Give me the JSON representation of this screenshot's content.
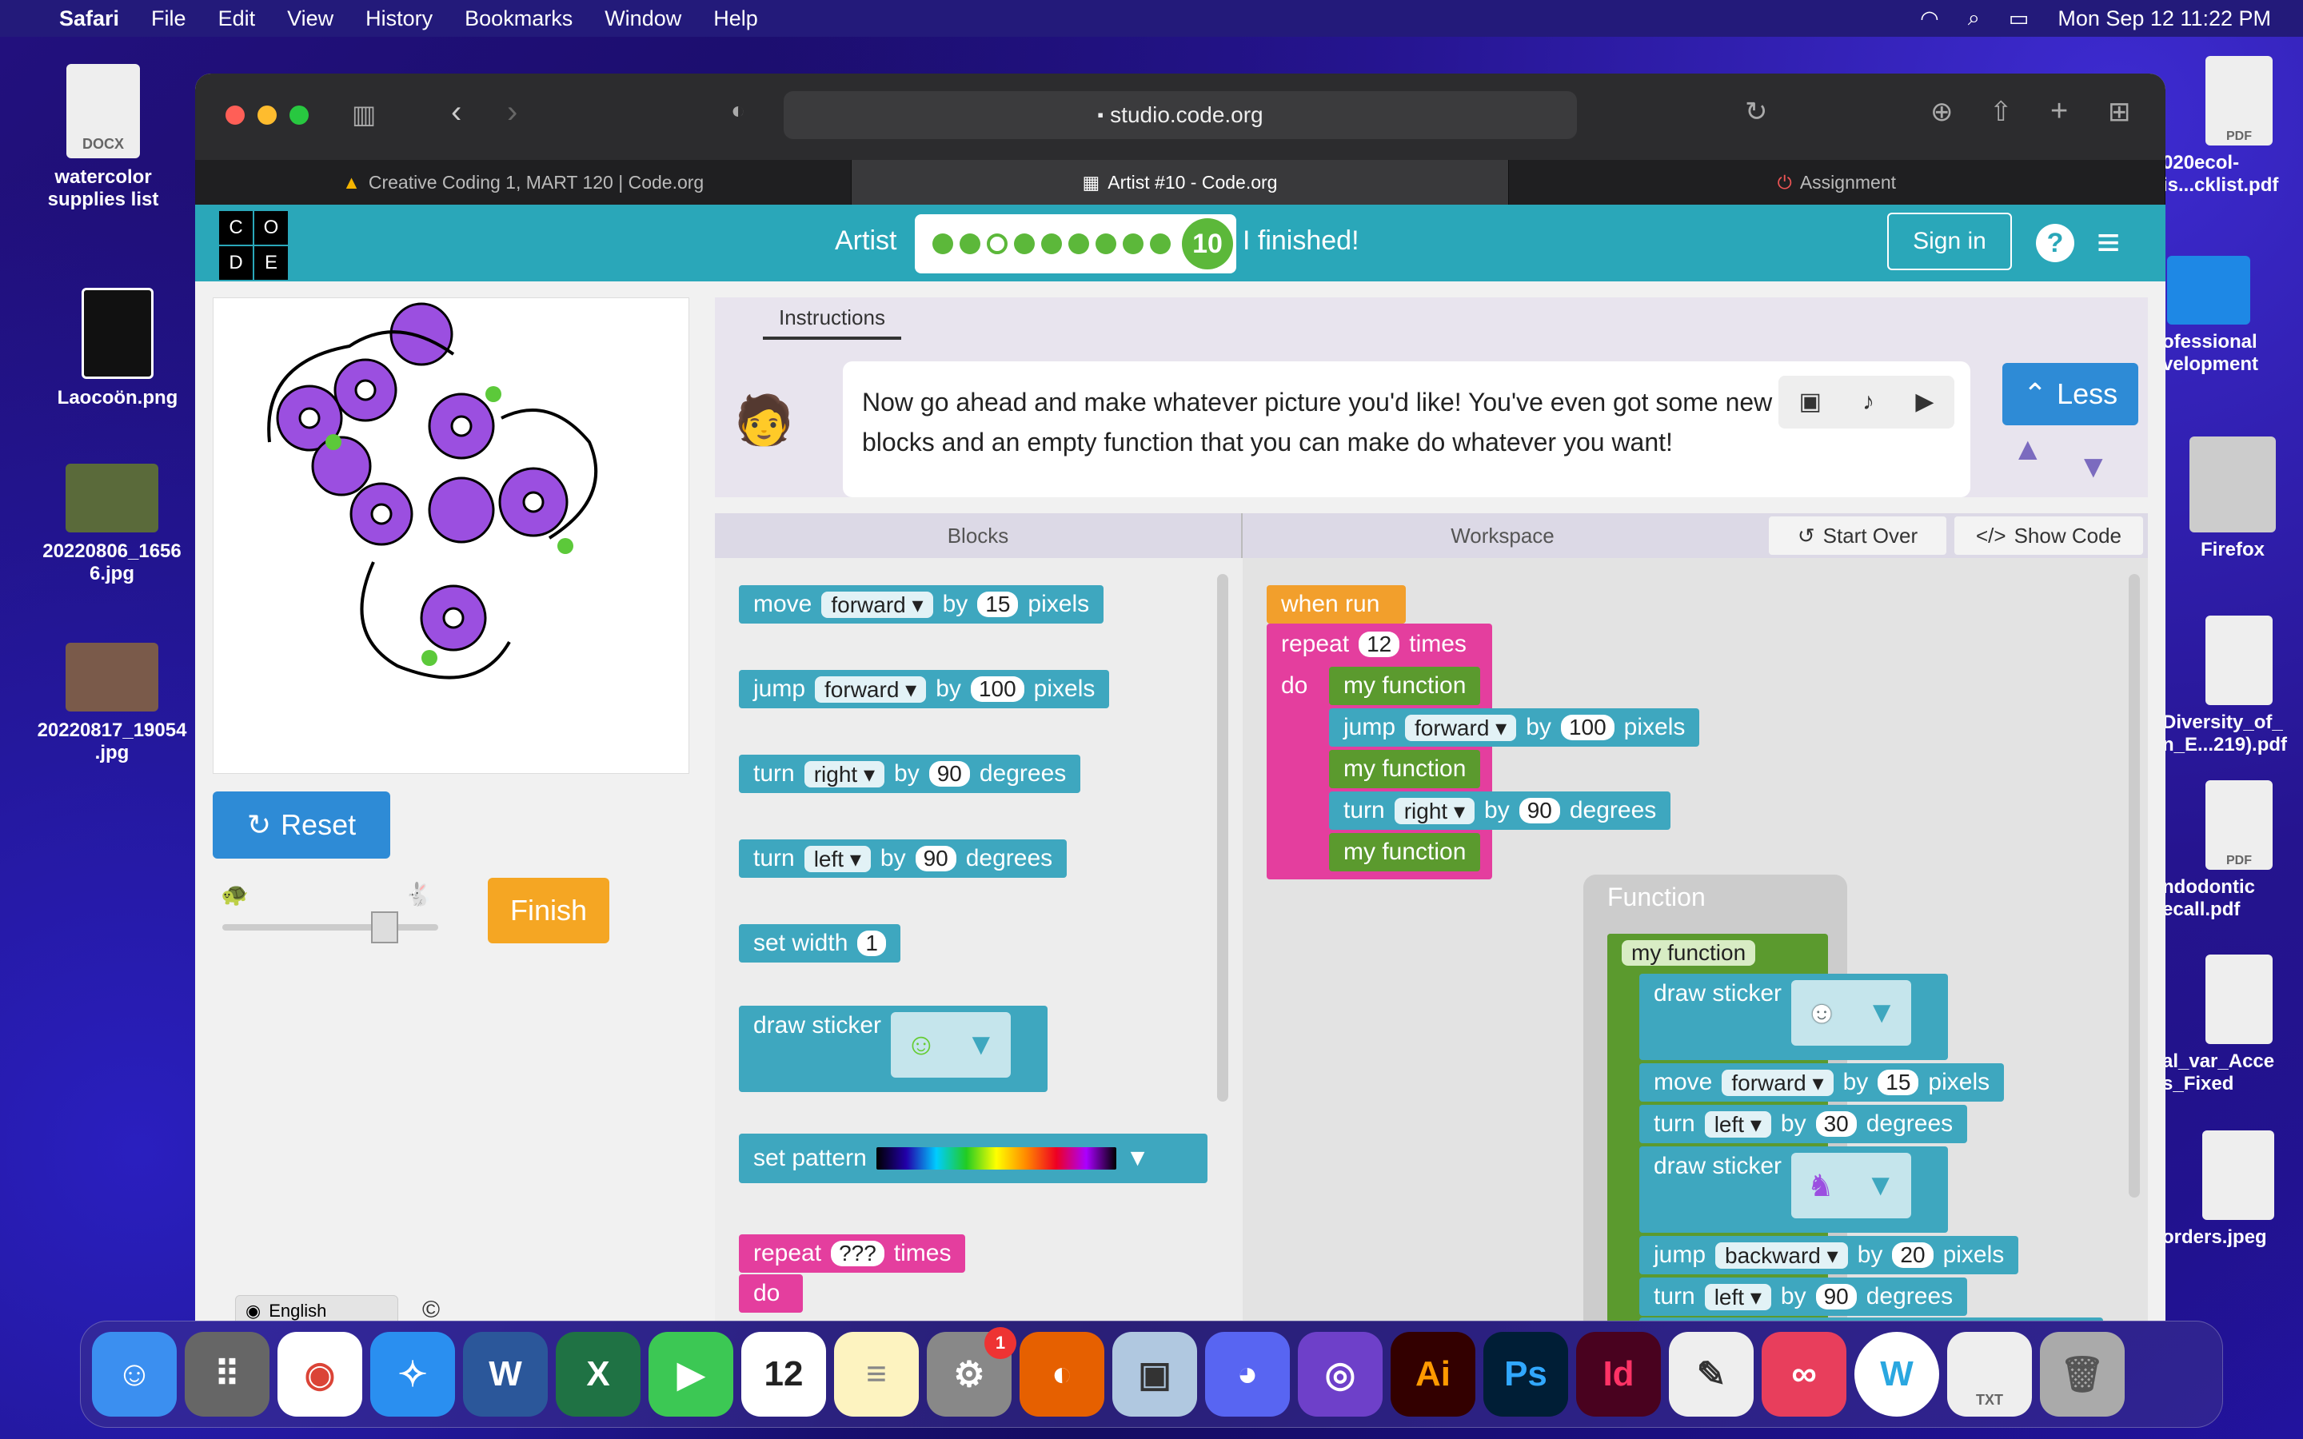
{
  "menubar": {
    "app": "Safari",
    "items": [
      "File",
      "Edit",
      "View",
      "History",
      "Bookmarks",
      "Window",
      "Help"
    ],
    "clock": "Mon Sep 12  11:22 PM"
  },
  "desktop": {
    "left": [
      "watercolor supplies list",
      "Laocoön.png",
      "20220806_16566.jpg",
      "20220817_190546.jpg"
    ],
    "left_display": [
      "watercolor\nsupplies list",
      "Laocoön.png",
      "20220806_1656\n6.jpg",
      "20220817_19054\n.jpg"
    ],
    "right": [
      "020ecol-is...cklist.pdf",
      "ofessional velopment",
      "Firefox",
      "Diversity_of_ n_E...219).pdf",
      "ndodontic ecall.pdf",
      "al_var_Acce s_Fixed",
      "orders.jpeg"
    ],
    "docx_label": "DOCX",
    "pdf_label": "PDF",
    "txt_label": "TXT"
  },
  "browser": {
    "url": "studio.code.org",
    "tabs": [
      "Creative Coding 1, MART 120 | Code.org",
      "Artist #10 - Code.org",
      "Assignment"
    ]
  },
  "header": {
    "logo": [
      "C",
      "O",
      "D",
      "E"
    ],
    "puzzle": "Artist",
    "level": "10",
    "finished": "I finished!",
    "signin": "Sign in"
  },
  "controls": {
    "reset": "Reset",
    "finish": "Finish",
    "language": "English"
  },
  "instructions": {
    "tab": "Instructions",
    "text": "Now go ahead and make whatever picture you'd like! You've even got some new blocks and an empty function that you can make do whatever you want!",
    "less": "Less"
  },
  "panels": {
    "blocks": "Blocks",
    "workspace": "Workspace",
    "start_over": "Start Over",
    "show_code": "Show Code"
  },
  "toolbox": {
    "move": "move",
    "forward": "forward",
    "by": "by",
    "fifteen": "15",
    "pixels": "pixels",
    "jump": "jump",
    "hundred": "100",
    "turn": "turn",
    "right": "right",
    "ninety": "90",
    "degrees": "degrees",
    "left": "left",
    "set_width": "set width",
    "one": "1",
    "draw_sticker": "draw sticker",
    "set_pattern": "set pattern",
    "repeat": "repeat",
    "qqq": "???",
    "times": "times",
    "do": "do"
  },
  "workspace_blocks": {
    "when_run": "when run",
    "repeat": "repeat",
    "twelve": "12",
    "times": "times",
    "do": "do",
    "my_function": "my function",
    "function_title": "Function",
    "backward": "backward",
    "twenty": "20",
    "thirty": "30"
  },
  "colors": {
    "teal": "#2aa7b9",
    "block_teal": "#3ea7bf",
    "green": "#5b9a2e",
    "pink": "#e43e9e",
    "orange": "#f29f2c",
    "finish": "#f5a623",
    "reset": "#2e8bd6"
  }
}
